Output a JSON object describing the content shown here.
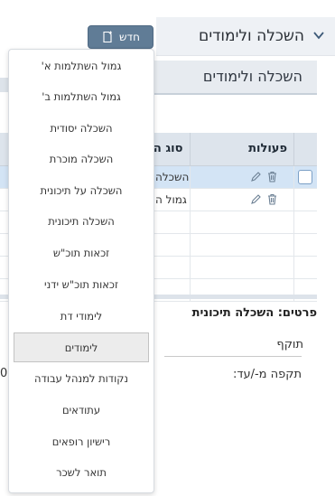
{
  "header": {
    "title": "השכלה ולימודים",
    "new_button": "חדש"
  },
  "subheader": {
    "title": "השכלה ולימודים"
  },
  "grid": {
    "columns": {
      "actions": "פעולות",
      "type": "סוג הש"
    },
    "rows": [
      {
        "type": "השכלה",
        "selected": true
      },
      {
        "type": "גמול ה",
        "selected": false
      }
    ]
  },
  "details": {
    "title": "פרטים: השכלה תיכונית",
    "valid_label": "תוקף",
    "period_label": "תקפה מ-/עד:",
    "left_value": "0"
  },
  "menu": {
    "items": [
      "גמול השתלמות א'",
      "גמול השתלמות ב'",
      "השכלה יסודית",
      "השכלה מוכרת",
      "השכלה על תיכונית",
      "השכלה תיכונית",
      "זכאות תוכ\"ש",
      "זכאות תוכ\"ש ידני",
      "לימודי דת",
      "לימודים",
      "נקודות למנהל עבודה",
      "עתודאים",
      "רישיון רופאים",
      "תואר לשכר"
    ],
    "highlighted_index": 9
  }
}
